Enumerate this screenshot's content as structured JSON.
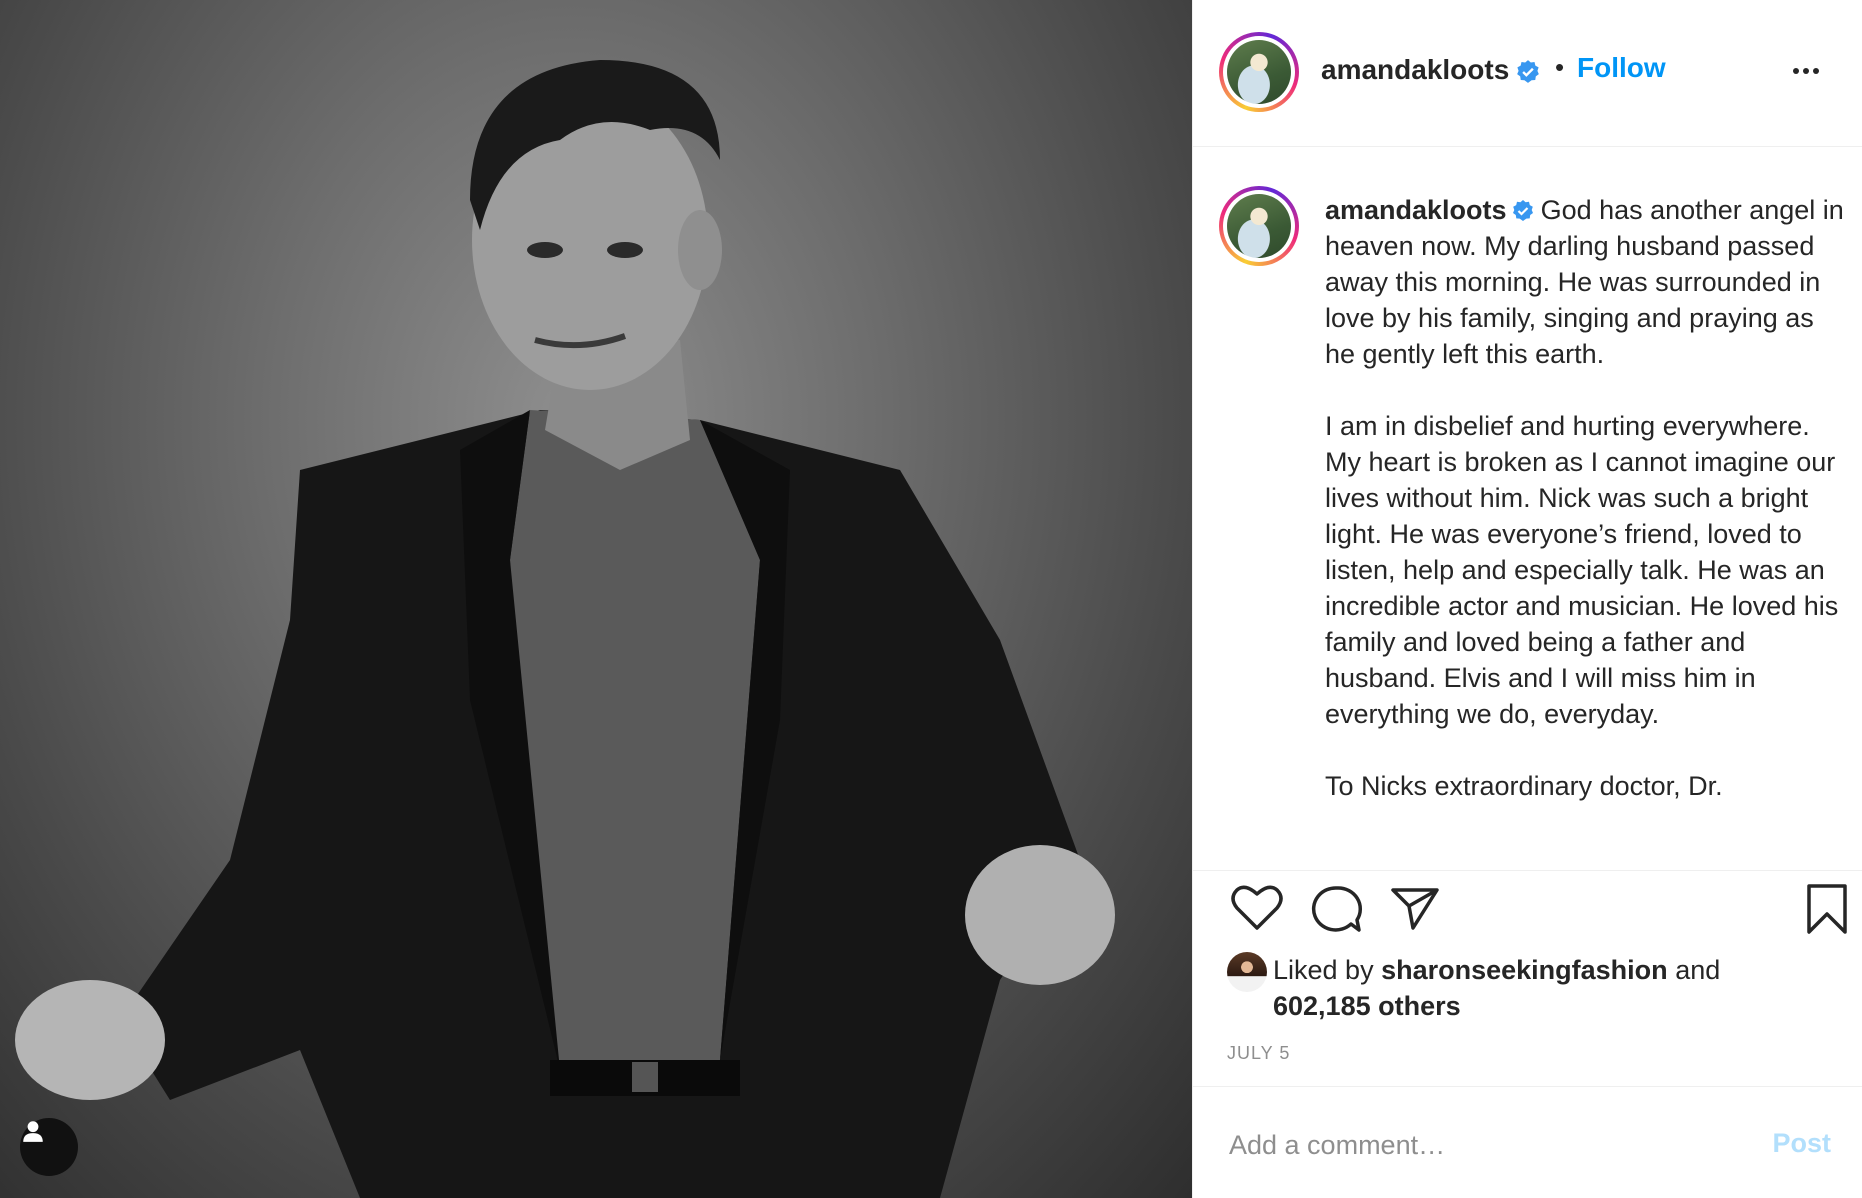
{
  "post": {
    "username": "amandakloots",
    "follow_label": "Follow",
    "dot": "•",
    "caption_lines": [
      "God has another angel in heaven now. My darling husband passed away this morning. He was surrounded in love by his family, singing and praying as he gently left this earth.",
      "I am in disbelief and hurting everywhere. My heart is broken as I cannot imagine our lives without him. Nick was such a bright light. He was everyone’s friend, loved to listen, help and especially talk. He was an incredible actor and musician. He loved his family and loved being a father and husband. Elvis and I will miss him in everything we do, everyday.",
      "To Nicks extraordinary doctor, Dr."
    ],
    "liked_prefix": "Liked by",
    "liked_user": "sharonseekingfashion",
    "liked_and": "and",
    "liked_others": "602,185 others",
    "date": "JULY 5",
    "comment_placeholder": "Add a comment…",
    "post_label": "Post"
  },
  "colors": {
    "accent": "#0095f6",
    "post_disabled": "#b2dffc",
    "text": "#262626",
    "muted": "#8e8e8e"
  },
  "icons": [
    "verified-badge-icon",
    "more-options-icon",
    "heart-icon",
    "comment-icon",
    "share-icon",
    "bookmark-icon",
    "user-tag-icon"
  ]
}
